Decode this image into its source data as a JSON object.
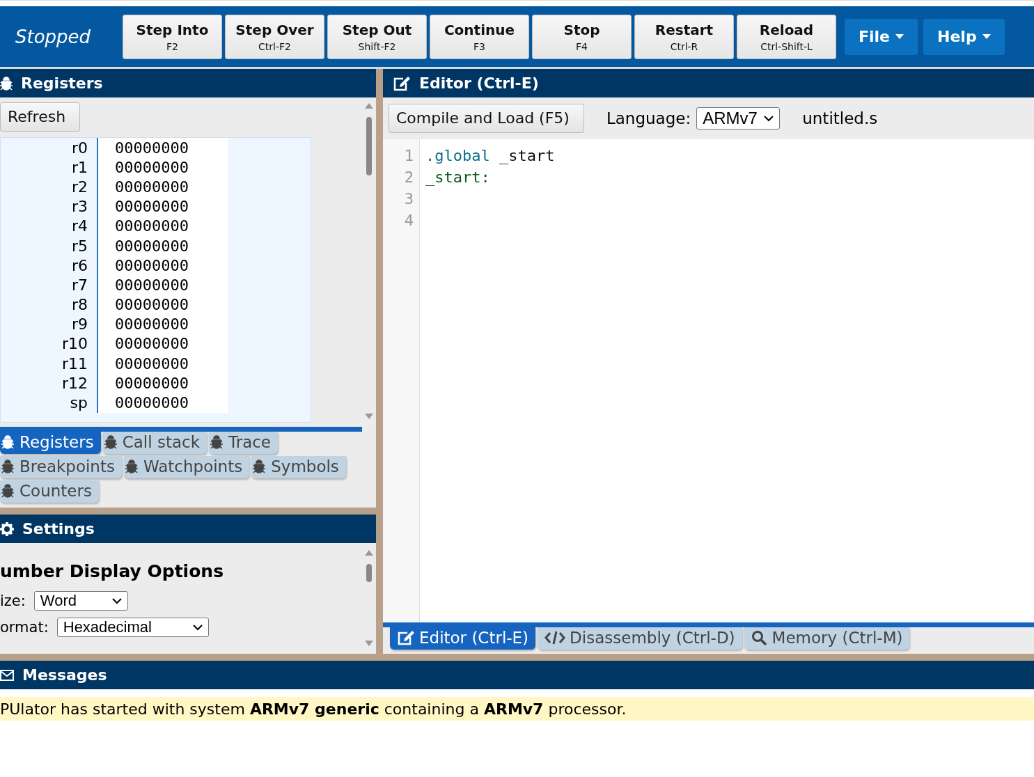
{
  "status": "Stopped",
  "toolbar": [
    {
      "label": "Step Into",
      "shortcut": "F2"
    },
    {
      "label": "Step Over",
      "shortcut": "Ctrl-F2"
    },
    {
      "label": "Step Out",
      "shortcut": "Shift-F2"
    },
    {
      "label": "Continue",
      "shortcut": "F3"
    },
    {
      "label": "Stop",
      "shortcut": "F4"
    },
    {
      "label": "Restart",
      "shortcut": "Ctrl-R"
    },
    {
      "label": "Reload",
      "shortcut": "Ctrl-Shift-L"
    }
  ],
  "menus": [
    "File",
    "Help"
  ],
  "registers_panel": {
    "title": "Registers",
    "refresh": "Refresh",
    "registers": [
      {
        "name": "r0",
        "value": "00000000"
      },
      {
        "name": "r1",
        "value": "00000000"
      },
      {
        "name": "r2",
        "value": "00000000"
      },
      {
        "name": "r3",
        "value": "00000000"
      },
      {
        "name": "r4",
        "value": "00000000"
      },
      {
        "name": "r5",
        "value": "00000000"
      },
      {
        "name": "r6",
        "value": "00000000"
      },
      {
        "name": "r7",
        "value": "00000000"
      },
      {
        "name": "r8",
        "value": "00000000"
      },
      {
        "name": "r9",
        "value": "00000000"
      },
      {
        "name": "r10",
        "value": "00000000"
      },
      {
        "name": "r11",
        "value": "00000000"
      },
      {
        "name": "r12",
        "value": "00000000"
      },
      {
        "name": "sp",
        "value": "00000000"
      }
    ]
  },
  "debug_tabs": [
    {
      "label": "Registers",
      "selected": true
    },
    {
      "label": "Call stack",
      "selected": false
    },
    {
      "label": "Trace",
      "selected": false
    },
    {
      "label": "Breakpoints",
      "selected": false
    },
    {
      "label": "Watchpoints",
      "selected": false
    },
    {
      "label": "Symbols",
      "selected": false
    },
    {
      "label": "Counters",
      "selected": false
    }
  ],
  "settings": {
    "title": "Settings",
    "heading": "umber Display Options",
    "size": {
      "label": "ize:",
      "value": "Word"
    },
    "format": {
      "label": "ormat:",
      "value": "Hexadecimal"
    }
  },
  "editor": {
    "title": "Editor (Ctrl-E)",
    "compile": "Compile and Load (F5)",
    "language_label": "Language:",
    "language": "ARMv7",
    "filename": "untitled.s",
    "lines": [
      {
        "number": "1",
        "code": [
          {
            "kind": "directive",
            "text": ".global"
          },
          {
            "kind": "plain",
            "text": " _start"
          }
        ]
      },
      {
        "number": "2",
        "code": [
          {
            "kind": "label",
            "text": "_start:"
          }
        ]
      },
      {
        "number": "3"
      },
      {
        "number": "4"
      }
    ]
  },
  "editor_tabs": [
    {
      "label": "Editor (Ctrl-E)",
      "kind": "edit",
      "selected": true
    },
    {
      "label": "Disassembly (Ctrl-D)",
      "kind": "code",
      "selected": false
    },
    {
      "label": "Memory (Ctrl-M)",
      "kind": "search",
      "selected": false
    }
  ],
  "messages": {
    "title": "Messages",
    "text": "PUlator has started with system **ARMv7 generic** containing a **ARMv7** processor."
  }
}
